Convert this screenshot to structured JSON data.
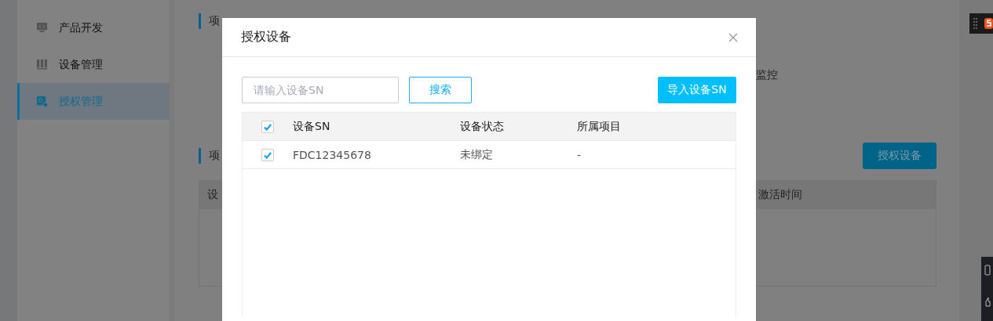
{
  "sidebar": {
    "items": [
      {
        "label": "产品开发",
        "selected": false
      },
      {
        "label": "设备管理",
        "selected": false
      },
      {
        "label": "授权管理",
        "selected": true
      }
    ]
  },
  "page": {
    "section_1_heading": "项",
    "info_text": "监控",
    "section_2_heading": "项",
    "authorize_button": "授权设备",
    "table": {
      "columns": [
        "设",
        "激活时间"
      ]
    }
  },
  "dialog": {
    "title": "授权设备",
    "search": {
      "placeholder": "请输入设备SN"
    },
    "search_button": "搜索",
    "import_button": "导入设备SN",
    "table": {
      "select_all_checked": true,
      "columns": [
        "设备SN",
        "设备状态",
        "所属项目"
      ],
      "rows": [
        {
          "checked": true,
          "cells": [
            "FDC12345678",
            "未绑定",
            "-"
          ]
        }
      ]
    }
  }
}
